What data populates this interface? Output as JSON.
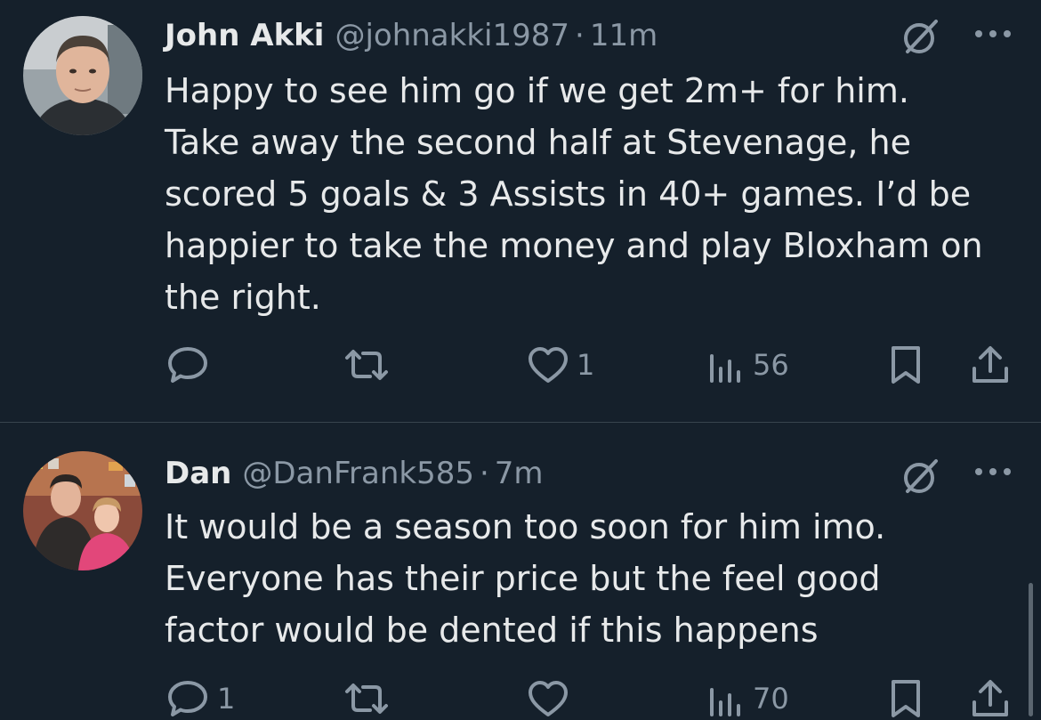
{
  "tweets": [
    {
      "author_name": "John Akki",
      "handle": "@johnakki1987",
      "separator": "·",
      "time": "11m",
      "lines": [
        "Happy to see him go if we get 2m+ for him.",
        "Take away the second half at Stevenage, he",
        "scored 5 goals & 3 Assists in 40+ games. I’d be",
        "happier to take the money and play Bloxham on",
        "the right."
      ],
      "reply_count": "",
      "retweet_count": "",
      "like_count": "1",
      "view_count": "56"
    },
    {
      "author_name": "Dan",
      "handle": "@DanFrank585",
      "separator": "·",
      "time": "7m",
      "lines": [
        "It would be a season too soon for him imo.",
        "Everyone has their price but the feel good",
        "factor would be dented if this happens"
      ],
      "reply_count": "1",
      "retweet_count": "",
      "like_count": "",
      "view_count": "70"
    }
  ],
  "icons": {
    "reply": "reply-icon",
    "retweet": "retweet-icon",
    "like": "heart-icon",
    "views": "views-icon",
    "bookmark": "bookmark-icon",
    "share": "share-icon",
    "grok": "grok-icon",
    "more": "more-icon"
  },
  "colors": {
    "background": "#15202b",
    "primary_text": "#e7e9ea",
    "secondary_text": "#8b98a5",
    "divider": "#38444d"
  }
}
